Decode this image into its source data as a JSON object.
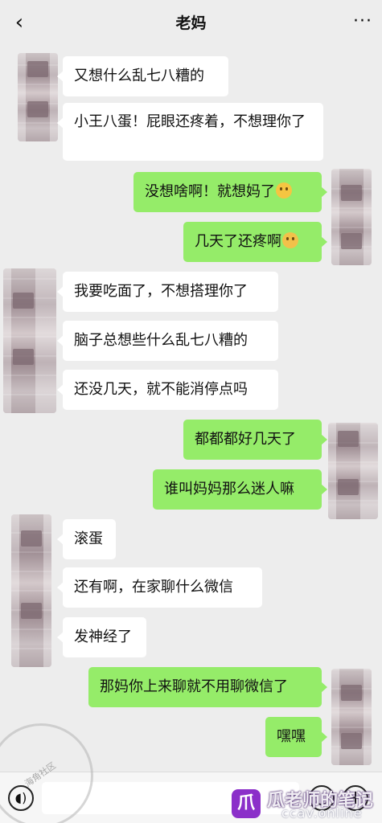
{
  "header": {
    "back_icon": "chevron-left-icon",
    "title": "老妈",
    "more_icon": "more-dots-icon"
  },
  "messages": [
    {
      "side": "left",
      "text": "又想什么乱七八糟的"
    },
    {
      "side": "left",
      "text": "小王八蛋！屁眼还疼着，不想理你了"
    },
    {
      "side": "right",
      "text": "没想啥啊！就想妈了",
      "emoji": "pout-face-emoji"
    },
    {
      "side": "right",
      "text": "几天了还疼啊",
      "emoji": "laugh-cry-emoji"
    },
    {
      "side": "left",
      "text": "我要吃面了，不想搭理你了"
    },
    {
      "side": "left",
      "text": "脑子总想些什么乱七八糟的"
    },
    {
      "side": "left",
      "text": "还没几天，就不能消停点吗"
    },
    {
      "side": "right",
      "text": "都都都好几天了"
    },
    {
      "side": "right",
      "text": "谁叫妈妈那么迷人嘛"
    },
    {
      "side": "left",
      "text": "滚蛋"
    },
    {
      "side": "left",
      "text": "还有啊，在家聊什么微信"
    },
    {
      "side": "left",
      "text": "发神经了"
    },
    {
      "side": "right",
      "text": "那妈你上来聊就不用聊微信了"
    },
    {
      "side": "right",
      "text": "嘿嘿"
    }
  ],
  "bottom_bar": {
    "voice_icon": "voice-icon",
    "emoji_icon": "emoji-icon",
    "plus_icon": "plus-icon"
  },
  "watermark": {
    "circle_text": "海角社区",
    "brand_text": "瓜老师的笔记",
    "url": "ccav.online",
    "logo_glyph": "爪"
  },
  "colors": {
    "background": "#ededed",
    "left_bubble": "#ffffff",
    "right_bubble": "#95ec69",
    "logo": "#8b2fc9"
  }
}
